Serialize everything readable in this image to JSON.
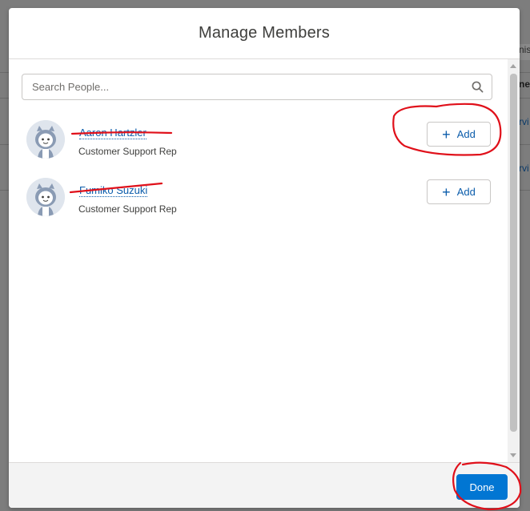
{
  "background": {
    "strip1_text": "nis",
    "strip2_text": "ne",
    "strip3_text": "rvi",
    "strip4_text": "rvi"
  },
  "modal": {
    "title": "Manage Members",
    "search": {
      "placeholder": "Search People...",
      "value": ""
    },
    "people": [
      {
        "name": "Aaron Hartzler",
        "role": "Customer Support Rep",
        "action_label": "Add"
      },
      {
        "name": "Fumiko Suzuki",
        "role": "Customer Support Rep",
        "action_label": "Add"
      }
    ],
    "footer": {
      "done_label": "Done"
    }
  },
  "colors": {
    "link": "#0b5cab",
    "brand": "#0176d3",
    "annotation": "#e0101a"
  },
  "icons": {
    "search": "search-icon",
    "add": "plus-icon",
    "avatar": "astro-avatar-icon"
  }
}
